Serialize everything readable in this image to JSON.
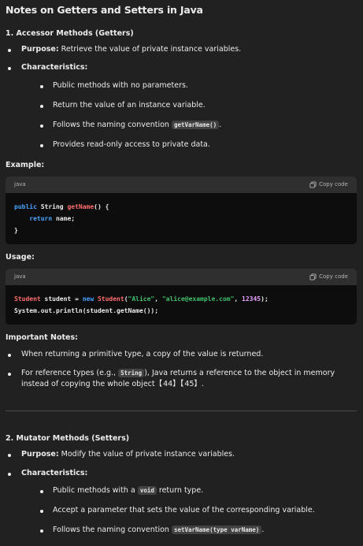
{
  "title": "Notes on Getters and Setters in Java",
  "getters": {
    "heading": "1. Accessor Methods (Getters)",
    "purpose_label": "Purpose:",
    "purpose_text": " Retrieve the value of private instance variables.",
    "characteristics_label": "Characteristics:",
    "characteristics": [
      "Public methods with no parameters.",
      "Return the value of an instance variable.",
      "Follows the naming convention ",
      "Provides read-only access to private data."
    ],
    "naming_code": "getVarName()",
    "naming_suffix": "."
  },
  "example": {
    "label": "Example:",
    "lang": "java",
    "copy_label": "Copy code",
    "line1": {
      "kw": "public",
      "type": " String ",
      "fn": "getName",
      "rest": "() {"
    },
    "line2": {
      "indent": "    ",
      "kw": "return",
      "rest": " name;"
    },
    "line3": "}"
  },
  "usage": {
    "label": "Usage:",
    "lang": "java",
    "copy_label": "Copy code",
    "line1": {
      "type": "Student",
      "var": " student = ",
      "kw": "new",
      "ctor": " Student",
      "open": "(",
      "s1": "\"Alice\"",
      "c1": ", ",
      "s2": "\"alice@example.com\"",
      "c2": ", ",
      "num": "12345",
      "close": ");"
    },
    "line2": "System.out.println(student.getName());"
  },
  "notes": {
    "label": "Important Notes:",
    "item1": "When returning a primitive type, a copy of the value is returned.",
    "item2_pre": "For reference types (e.g., ",
    "item2_code": "String",
    "item2_post": "), Java returns a reference to the object in memory instead of copying the whole object【 44】【 45】."
  },
  "setters": {
    "heading": "2. Mutator Methods (Setters)",
    "purpose_label": "Purpose:",
    "purpose_text": " Modify the value of private instance variables.",
    "characteristics_label": "Characteristics:",
    "item1_pre": "Public methods with a ",
    "item1_code": "void",
    "item1_post": " return type.",
    "item2": "Accept a parameter that sets the value of the corresponding variable.",
    "item3_pre": "Follows the naming convention ",
    "item3_code": "setVarName(type varName)",
    "item3_post": "."
  }
}
